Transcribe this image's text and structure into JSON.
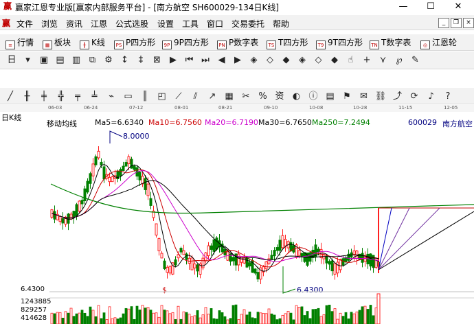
{
  "titlebar": {
    "logo": "赢",
    "title": "赢家江恩专业版[赢家内部服务平台] - [南方航空  SH600029-134日K线]"
  },
  "window_controls": {
    "minimize": "—",
    "maximize": "☐",
    "close": "✕"
  },
  "menubar": {
    "logo": "赢",
    "items": [
      "文件",
      "浏览",
      "资讯",
      "江恩",
      "公式选股",
      "设置",
      "工具",
      "窗口",
      "交易委托",
      "帮助"
    ],
    "mdi": [
      "_",
      "❐",
      "×"
    ]
  },
  "toolbar1": [
    {
      "label": "行情",
      "icon": "list-icon",
      "glyph": "≡"
    },
    {
      "label": "板块",
      "icon": "grid-icon",
      "glyph": "▦"
    },
    {
      "label": "K线",
      "icon": "candle-icon",
      "glyph": "╫"
    },
    {
      "label": "P四方形",
      "icon": "p-square-icon",
      "glyph": "PS"
    },
    {
      "label": "9P四方形",
      "icon": "9p-square-icon",
      "glyph": "9P"
    },
    {
      "label": "P数字表",
      "icon": "p-number-table-icon",
      "glyph": "PN"
    },
    {
      "label": "T四方形",
      "icon": "t-square-icon",
      "glyph": "TS"
    },
    {
      "label": "9T四方形",
      "icon": "9t-square-icon",
      "glyph": "T9"
    },
    {
      "label": "T数字表",
      "icon": "t-number-table-icon",
      "glyph": "TN"
    },
    {
      "label": "江恩轮",
      "icon": "gann-wheel-icon",
      "glyph": "◎"
    }
  ],
  "toolbar2": [
    {
      "icon": "period-day-icon",
      "glyph": "日"
    },
    {
      "icon": "dropdown-icon",
      "glyph": "▾"
    },
    {
      "icon": "calendar-icon",
      "glyph": "▣"
    },
    {
      "icon": "chart-grid-icon",
      "glyph": "▤"
    },
    {
      "icon": "save-icon",
      "glyph": "▥"
    },
    {
      "icon": "copy-icon",
      "glyph": "⧉"
    },
    {
      "icon": "settings-icon",
      "glyph": "⚙"
    },
    {
      "icon": "cursor-icon",
      "glyph": "↕"
    },
    {
      "icon": "bar-chart-icon",
      "glyph": "‡"
    },
    {
      "icon": "indicator-icon",
      "glyph": "⊠"
    },
    {
      "icon": "flag-icon",
      "glyph": "▶"
    },
    {
      "icon": "go-first-icon",
      "glyph": "⏮"
    },
    {
      "icon": "go-last-icon",
      "glyph": "⏭"
    },
    {
      "icon": "move-left-icon",
      "glyph": "◀"
    },
    {
      "icon": "move-right-icon",
      "glyph": "▶"
    },
    {
      "icon": "zoom-in-icon",
      "glyph": "◈"
    },
    {
      "icon": "zoom-out-icon",
      "glyph": "◇"
    },
    {
      "icon": "scroll-up-icon",
      "glyph": "◆"
    },
    {
      "icon": "scroll-down-icon",
      "glyph": "◈"
    },
    {
      "icon": "expand-icon",
      "glyph": "◇"
    },
    {
      "icon": "shrink-icon",
      "glyph": "◆"
    },
    {
      "icon": "hand-icon",
      "glyph": "☝"
    },
    {
      "icon": "crosshair-icon",
      "glyph": "+"
    },
    {
      "icon": "line-tool-icon",
      "glyph": "⋎"
    },
    {
      "icon": "fib-icon",
      "glyph": "℘"
    },
    {
      "icon": "gann-fan-icon",
      "glyph": "✎"
    }
  ],
  "toolbar3": [
    {
      "icon": "pen-icon",
      "glyph": "╱"
    },
    {
      "icon": "gann-line-icon",
      "glyph": "╫"
    },
    {
      "icon": "channel-icon",
      "glyph": "╪"
    },
    {
      "icon": "fan-icon",
      "glyph": "╬"
    },
    {
      "icon": "arc-icon",
      "glyph": "╤"
    },
    {
      "icon": "cycle-icon",
      "glyph": "╧"
    },
    {
      "icon": "angle-icon",
      "glyph": "⌁"
    },
    {
      "icon": "rect-icon",
      "glyph": "▭"
    },
    {
      "icon": "time-zone-icon",
      "glyph": "║"
    },
    {
      "icon": "box-icon",
      "glyph": "◰"
    },
    {
      "icon": "ray-icon",
      "glyph": "⟋"
    },
    {
      "icon": "parallel-icon",
      "glyph": "⫽"
    },
    {
      "icon": "up-arrow-icon",
      "glyph": "↗"
    },
    {
      "icon": "table-icon",
      "glyph": "▦"
    },
    {
      "icon": "filter-icon",
      "glyph": "✂"
    },
    {
      "icon": "percent-icon",
      "glyph": "%"
    },
    {
      "icon": "finance-icon",
      "glyph": "资"
    },
    {
      "icon": "mark-icon",
      "glyph": "◐"
    },
    {
      "icon": "info-icon",
      "glyph": "ⓘ"
    },
    {
      "icon": "news-icon",
      "glyph": "▤"
    },
    {
      "icon": "alert-icon",
      "glyph": "⚑"
    },
    {
      "icon": "note-icon",
      "glyph": "✉"
    },
    {
      "icon": "link-icon",
      "glyph": "⛓"
    },
    {
      "icon": "trend-icon",
      "glyph": "⤴"
    },
    {
      "icon": "sync-icon",
      "glyph": "⟳"
    },
    {
      "icon": "bell-icon",
      "glyph": "♪"
    },
    {
      "icon": "help-icon",
      "glyph": "?"
    }
  ],
  "dates": [
    "06-03",
    "06-24",
    "07-12",
    "08-01",
    "08-21",
    "09-10",
    "10-08",
    "10-28",
    "11-15",
    "12-05"
  ],
  "chart": {
    "period_label": "日K线",
    "ma_title": "移动均线",
    "ma5": "Ma5=6.6340",
    "ma10": "Ma10=6.7560",
    "ma20": "Ma20=6.7190",
    "ma30": "Ma30=6.7650",
    "ma250": "Ma250=7.2494",
    "stock_code": "600029",
    "stock_name": "南方航空",
    "high_label": "8.0000",
    "low_label": "6.4300",
    "axis_price": "6.4300",
    "dollar_mark": "$",
    "volume_ticks": [
      "1243885",
      "829257",
      "414628"
    ],
    "colors": {
      "up": "#ff2020",
      "down": "#008000",
      "ma5": "#000000",
      "ma10": "#cc0000",
      "ma20": "#cc00cc",
      "ma30": "#000000",
      "ma250": "#008000",
      "purple": "#7030a0",
      "blue": "#0000c0"
    }
  },
  "chart_data": {
    "type": "candlestick",
    "x": [
      "06-03",
      "",
      "",
      "",
      "",
      "",
      "",
      "",
      "",
      "",
      "06-24",
      "",
      "",
      "",
      "",
      "",
      "",
      "",
      "",
      "",
      "",
      "",
      "07-12",
      "",
      "",
      "",
      "",
      "",
      "",
      "",
      "",
      "",
      "",
      "",
      "08-01",
      "",
      "",
      "",
      "",
      "",
      "",
      "",
      "",
      "",
      "",
      "",
      "08-21",
      "",
      "",
      "",
      "",
      "",
      "",
      "",
      "",
      "",
      "",
      "",
      "09-10",
      "",
      "",
      "",
      "",
      "",
      "",
      "",
      "",
      "",
      "",
      "",
      "10-08",
      "",
      "",
      "",
      "",
      "",
      "",
      "",
      "",
      "",
      "",
      "",
      "10-28",
      "",
      "",
      "",
      "",
      ""
    ],
    "series": [
      {
        "name": "Ma5",
        "values": []
      },
      {
        "name": "Ma10",
        "values": []
      },
      {
        "name": "Ma20",
        "values": []
      },
      {
        "name": "Ma30",
        "values": []
      },
      {
        "name": "Ma250",
        "values": []
      }
    ],
    "price_high": 8.0,
    "price_low": 6.43
  }
}
